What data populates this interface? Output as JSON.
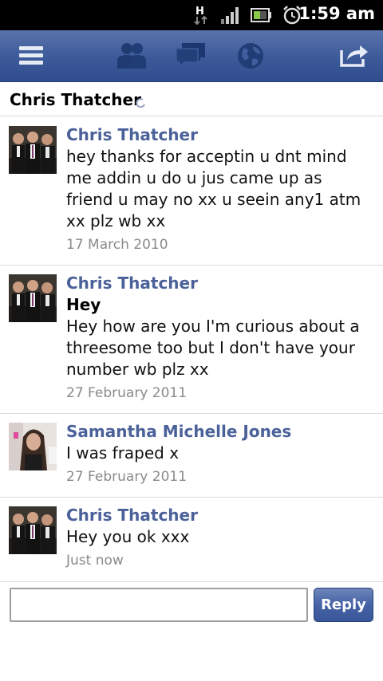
{
  "status_bar": {
    "time": "1:59 am",
    "network_type": "H",
    "icons": [
      "network-h-icon",
      "signal-icon",
      "battery-icon",
      "alarm-clock-icon"
    ]
  },
  "toolbar": {
    "icons": [
      "menu-icon",
      "friends-icon",
      "messages-icon",
      "notifications-globe-icon",
      "share-icon"
    ]
  },
  "thread": {
    "title": "Chris Thatcher"
  },
  "messages": [
    {
      "sender": "Chris Thatcher",
      "subject": "",
      "body": "hey thanks for acceptin u dnt mind me addin u do u jus came up as friend u may no xx u seein any1 atm xx plz wb xx",
      "date": "17 March 2010"
    },
    {
      "sender": "Chris Thatcher",
      "subject": "Hey",
      "body": "Hey how are you I'm curious about a threesome too but I don't have your number wb plz xx",
      "date": "27 February 2011"
    },
    {
      "sender": "Samantha Michelle Jones",
      "subject": "",
      "body": "I was fraped x",
      "date": "27 February 2011"
    },
    {
      "sender": "Chris Thatcher",
      "subject": "",
      "body": "Hey you ok xxx",
      "date": "Just now"
    }
  ],
  "composer": {
    "input_value": "",
    "placeholder": "",
    "reply_label": "Reply"
  },
  "colors": {
    "brand_blue": "#3c5a99",
    "sender_blue": "#4b6199",
    "date_gray": "#8a8a8a"
  }
}
